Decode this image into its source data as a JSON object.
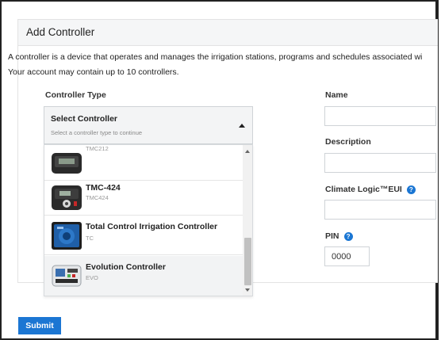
{
  "panel": {
    "title": "Add Controller",
    "description_line1": "A controller is a device that operates and manages the irrigation stations, programs and schedules associated wi",
    "description_line2": "Your account may contain up to 10 controllers."
  },
  "controller_type": {
    "label": "Controller Type",
    "select_title": "Select Controller",
    "select_hint": "Select a controller type to continue",
    "options": [
      {
        "name": "",
        "code": "TMC212"
      },
      {
        "name": "TMC-424",
        "code": "TMC424"
      },
      {
        "name": "Total Control Irrigation Controller",
        "code": "TC"
      },
      {
        "name": "Evolution Controller",
        "code": "EVO"
      }
    ]
  },
  "fields": {
    "name_label": "Name",
    "description_label": "Description",
    "climate_logic_label": "Climate Logic™EUI",
    "pin_label": "PIN",
    "pin_value": "0000",
    "help_glyph": "?"
  },
  "actions": {
    "submit_label": "Submit"
  },
  "colors": {
    "accent": "#1b76d3",
    "header_bg": "#f5f6f7"
  }
}
